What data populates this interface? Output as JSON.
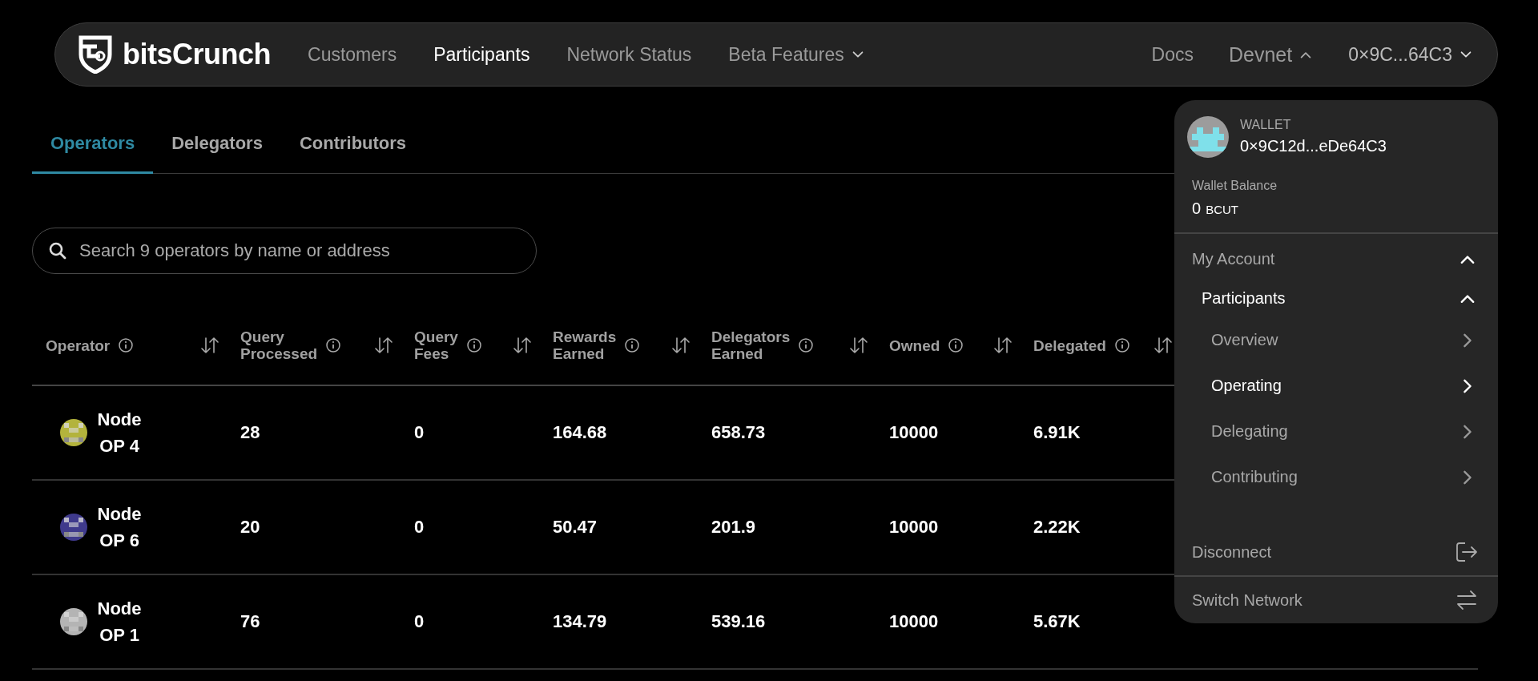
{
  "nav": {
    "logo_text": "bitsCrunch",
    "links": [
      {
        "label": "Customers",
        "selected": false,
        "kind": "link"
      },
      {
        "label": "Participants",
        "selected": true,
        "kind": "link"
      },
      {
        "label": "Network Status",
        "selected": false,
        "kind": "link"
      },
      {
        "label": "Beta Features",
        "selected": false,
        "kind": "dropdown"
      }
    ],
    "docs": "Docs",
    "network": {
      "label": "Devnet",
      "expanded": true
    },
    "account": {
      "label": "0×9C...64C3",
      "expanded": false
    }
  },
  "tabs": [
    {
      "label": "Operators",
      "selected": true
    },
    {
      "label": "Delegators",
      "selected": false
    },
    {
      "label": "Contributors",
      "selected": false
    }
  ],
  "search": {
    "placeholder": "Search 9 operators by name or address"
  },
  "table": {
    "columns": [
      {
        "label": "Operator"
      },
      {
        "label": "Query Processed"
      },
      {
        "label": "Query Fees"
      },
      {
        "label": "Rewards Earned"
      },
      {
        "label": "Delegators Earned"
      },
      {
        "label": "Owned"
      },
      {
        "label": "Delegated"
      }
    ],
    "rows": [
      {
        "color": "#b3b33c",
        "cells": [
          "Node OP 4",
          "28",
          "0",
          "164.68",
          "658.73",
          "10000",
          "6.91K"
        ]
      },
      {
        "color": "#3f3a8c",
        "cells": [
          "Node OP 6",
          "20",
          "0",
          "50.47",
          "201.9",
          "10000",
          "2.22K"
        ]
      },
      {
        "color": "#b4b4b4",
        "cells": [
          "Node OP 1",
          "76",
          "0",
          "134.79",
          "539.16",
          "10000",
          "5.67K"
        ]
      }
    ]
  },
  "wallet_menu": {
    "heading": "WALLET",
    "address": "0×9C12d...eDe64C3",
    "balance_label": "Wallet Balance",
    "balance_value": "0",
    "balance_unit": "BCUT",
    "sections": [
      {
        "label": "My Account",
        "expanded": true,
        "children": [
          {
            "label": "Participants",
            "expanded": true,
            "children": [
              {
                "label": "Overview",
                "selected": false
              },
              {
                "label": "Operating",
                "selected": true
              },
              {
                "label": "Delegating",
                "selected": false
              },
              {
                "label": "Contributing",
                "selected": false
              }
            ]
          }
        ]
      }
    ],
    "actions": [
      {
        "label": "Disconnect",
        "kind": "disconnect"
      },
      {
        "label": "Switch Network",
        "kind": "switch"
      }
    ]
  }
}
